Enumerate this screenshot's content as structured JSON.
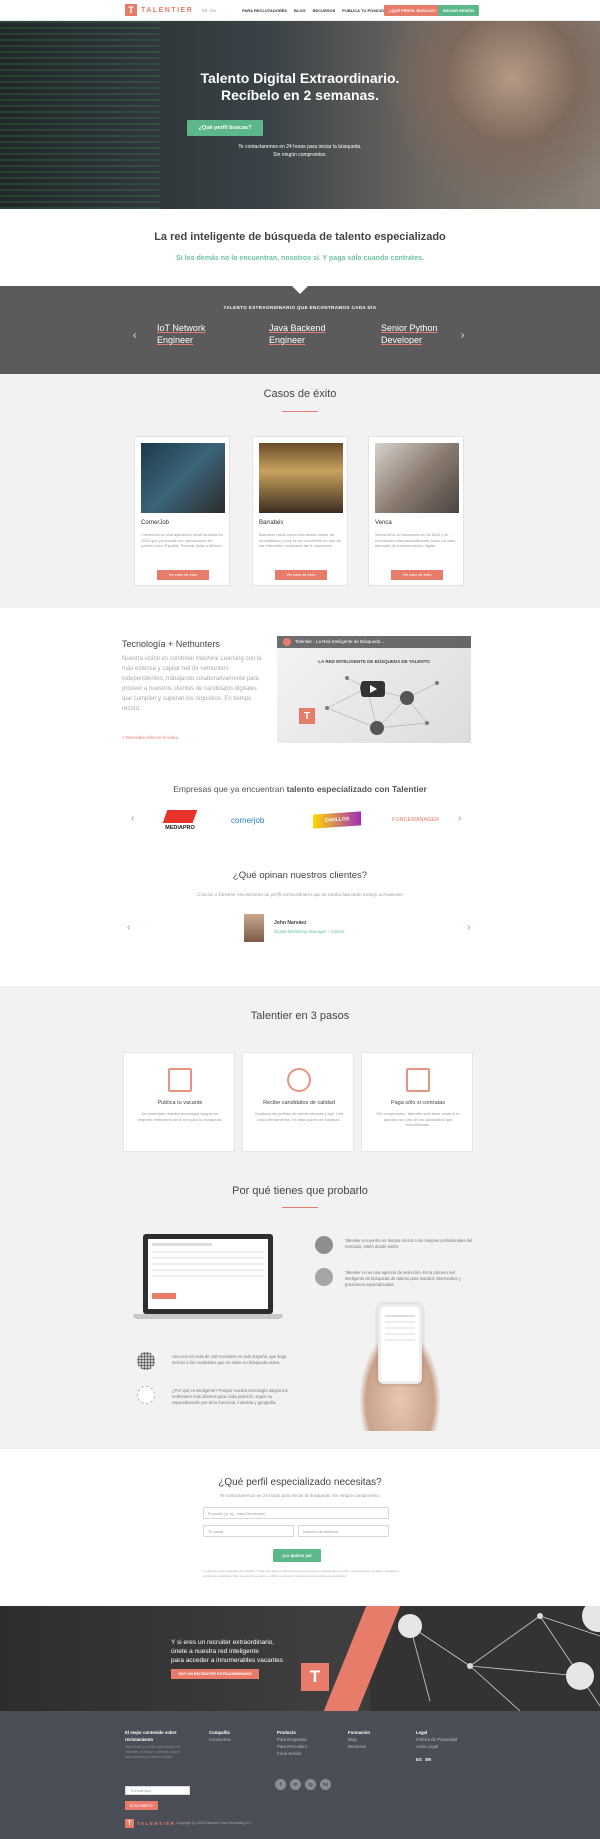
{
  "nav": {
    "logo_letter": "T",
    "logo_text": "TALENTIER",
    "lang_es": "ES",
    "lang_en": "EN",
    "links": [
      "PARA RECLUTADORES",
      "BLOG",
      "RECURSOS",
      "PUBLICA TU POSICIÓN"
    ],
    "cta_primary": "¿QUÉ PERFIL BUSCAS?",
    "cta_secondary": "INICIAR SESIÓN",
    "accent": "#e87c6a",
    "green": "#5cb88a"
  },
  "hero": {
    "title_line1": "Talento Digital Extraordinario.",
    "title_line2": "Recíbelo en 2 semanas.",
    "button": "¿Qué perfil buscas?",
    "sub_line1": "Te contactaremos en 24 horas para iniciar la búsqueda.",
    "sub_line2": "Sin ningún compromiso."
  },
  "tagline": {
    "title": "La red inteligente de búsqueda de talento especializado",
    "sub": "Si los demás no lo encuentran, nosotros sí. Y paga sólo cuando contrates."
  },
  "talent": {
    "heading": "TALENTO EXTRAORDINARIO QUE ENCONTRAMOS CADA DÍA",
    "items": [
      {
        "l1": "IoT Network",
        "l2": "Engineer"
      },
      {
        "l1": "Java Backend",
        "l2": "Engineer"
      },
      {
        "l1": "Senior Python",
        "l2": "Developer"
      }
    ],
    "prev": "‹",
    "next": "›"
  },
  "cases": {
    "title": "Casos de éxito",
    "cards": [
      {
        "name": "CornerJob",
        "text": "CornerJob es una aplicación móvil lanzada en 2015 que ya cuenta con operaciones en países como España, Francia, Italia o México.",
        "button": "Ver caso de éxito"
      },
      {
        "name": "Barrabés",
        "text": "Barrabés nació como una tienda online de montañismo y hoy se ha convertido en uno de los referentes mundiales del e-commerce.",
        "button": "Ver caso de éxito"
      },
      {
        "name": "Venca",
        "text": "Venca lleva la innovación en su ADN y se reconocida internacionalmente como un caso ejemplar de transformación digital.",
        "button": "Ver caso de éxito"
      }
    ]
  },
  "tech": {
    "title": "Tecnología + Nethunters",
    "text": "Nuestra visión es combinar Machine Learning con la más extensa y capilar red de nethunters independientes, trabajando colaborativamente para proveer a nuestros clientes de candidatos digitales que cumplen y superan los requisitos. En tiempo récord.",
    "link": "+ Descubre más en el vídeo",
    "video_title": "Talentier - La Red Inteligente de Búsqueda...",
    "video_caption": "LA RED INTELIGENTE DE BÚSQUEDA DE TALENTO"
  },
  "companies": {
    "title_prefix": "Empresas que ya encuentran ",
    "title_bold": "talento especializado con Talentier",
    "logos": [
      "MEDIAPRO",
      "cornerjob",
      "CHOLLOS",
      "FORCEMANAGER"
    ]
  },
  "testimonials": {
    "title": "¿Qué opinan nuestros clientes?",
    "quote": "Gracias a Talentier encontramos un perfil extraordinario que no estaba buscando trabajo activamente",
    "name": "John Narváez",
    "role": "Digital Marketing Manager - Cinesa"
  },
  "steps": {
    "title": "Talentier en 3 pasos",
    "items": [
      {
        "title": "Publica tu vacante",
        "text": "De inmediato nuestra tecnología asigna los mejores nethunters de la red para tu búsqueda."
      },
      {
        "title": "Recibe candidatos de calidad",
        "text": "Gestiona los perfiles de forma cómoda y ágil. Una única herramienta, en único punto de contacto."
      },
      {
        "title": "Paga sólo si contratas",
        "text": "Sin compromiso. Talentier sólo tiene coste si te quedas con uno de los candidatos que encontramos."
      }
    ]
  },
  "why": {
    "title": "Por qué tienes que probarlo",
    "points": [
      "Talentier encuentra en tiempo récord a los mejores profesionales del mercado, estén donde estén.",
      "Talentier no es una agencia de selección. Es la primera red inteligente de búsqueda de talento para mandos intermedios y posiciones especializadas.",
      "Una red con más de 150 recruiters en toda España, que llega incluso a los candidatos que no están en búsqueda activa.",
      "¿Por qué es inteligente? Porque nuestra tecnología asigna los nethunters más idóneos para cada posición, según su especialización por área funcional, industria y geografía."
    ]
  },
  "form": {
    "title": "¿Qué perfil especializado necesitas?",
    "sub": "Te contactaremos en 24 horas para iniciar la búsqueda. Sin ningún compromiso.",
    "position_placeholder": "Posición (p. ej.: Java Developer)",
    "email_placeholder": "Tu email",
    "phone_placeholder": "Número de teléfono",
    "submit": "¡Lo quiero ya!",
    "legal": "Tu derecho está protegido por Talentier. Tratar sus datos es información para procesar tu búsqueda. Al enviar y comunicarnos tus datos, aceptas la política de privacidad. Para acceder a tus datos, rectificar o eliminar, consulta nuestra política de privacidad."
  },
  "join": {
    "line1": "Y si eres un recruiter extraordinario,",
    "line2": "únete a nuestra red inteligente",
    "line3": "para acceder a innumerables vacantes",
    "button": "SOY UN RECRUITER EXTRAORDINARIO",
    "letter": "T"
  },
  "footer": {
    "newsletter_title": "El mejor contenido sobre reclutamiento",
    "newsletter_text": "Suscríbete y recibe información de Talentier, el mejor contenido sobre reclutamiento y talento digital.",
    "email_placeholder": "Tu email aquí",
    "subscribe": "SUSCRIBIRTE",
    "cols": [
      {
        "title": "Compañía",
        "items": [
          "Conócenos"
        ]
      },
      {
        "title": "Producto",
        "items": [
          "Para Empresas",
          "Para Recruiters",
          "Inicia Sesión"
        ]
      },
      {
        "title": "Formación",
        "items": [
          "Blog",
          "Recursos"
        ]
      },
      {
        "title": "Legal",
        "items": [
          "Política de Privacidad",
          "Aviso Legal"
        ]
      }
    ],
    "langs": "ES   EN",
    "social": [
      "f",
      "in",
      "ig",
      "tw"
    ],
    "copyright": "Copyright (c) 2018 Talentier Lean Recruiting S.L."
  }
}
